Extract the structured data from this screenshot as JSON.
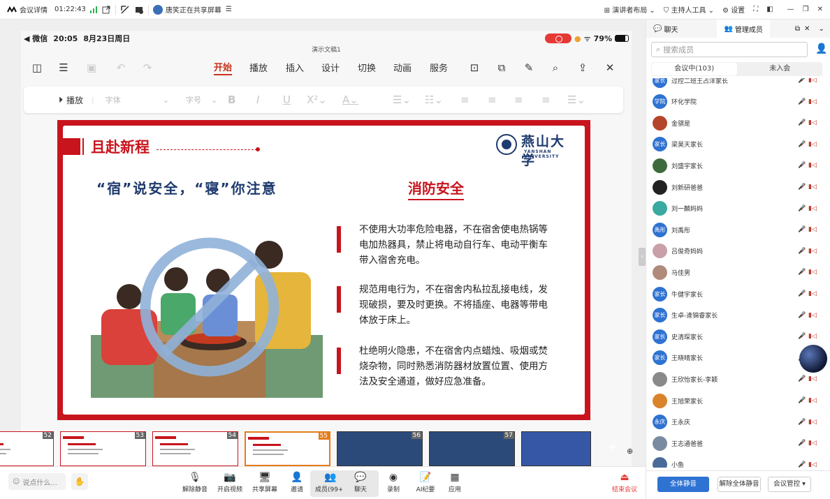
{
  "topbar": {
    "meeting_info": "会议详情",
    "timer": "01:22:43",
    "sharing_text": "唐笑正在共享屏幕",
    "presenter_layout": "演讲者布局",
    "host_tools": "主持人工具",
    "settings": "设置"
  },
  "phone": {
    "back_app": "◀ 微信",
    "time": "20:05",
    "date": "8月23日周日",
    "battery": "79%",
    "doc_title": "演示文稿1"
  },
  "app": {
    "tabs": [
      "开始",
      "播放",
      "插入",
      "设计",
      "切换",
      "动画",
      "服务"
    ],
    "active_tab": "开始"
  },
  "ribbon": {
    "play_label": "播放",
    "font": "字体",
    "size": "字号"
  },
  "slide": {
    "title": "且赴新程",
    "logo_cn": "燕山大学",
    "logo_en": "YANSHAN UNIVERSITY",
    "headline": "“宿”说安全，“寝”你注意",
    "section": "消防安全",
    "paragraphs": [
      "不使用大功率危险电器，不在宿舍使电热锅等电加热器具，禁止将电动自行车、电动平衡车带入宿舍充电。",
      "规范用电行为，不在宿舍内私拉乱接电线，发现破损，要及时更换。不将插座、电器等带电体放于床上。",
      "杜绝明火隐患，不在宿舍内点蜡烛、吸烟或焚烧杂物，同时熟悉消防器材放置位置、使用方法及安全通道，做好应急准备。"
    ]
  },
  "filmstrip": {
    "thumbs": [
      {
        "num": "52"
      },
      {
        "num": "53"
      },
      {
        "num": "54"
      },
      {
        "num": "55"
      },
      {
        "num": "56"
      },
      {
        "num": "57"
      }
    ],
    "selected": "55"
  },
  "bottombar": {
    "say_placeholder": "说点什么...",
    "buttons": [
      "解除静音",
      "开启视频",
      "共享屏幕",
      "邀请",
      "成员(99+)",
      "聊天",
      "录制",
      "AI纪要",
      "应用"
    ],
    "end": "结束会议"
  },
  "panel": {
    "tab_chat": "聊天",
    "tab_members": "管理成员",
    "search_placeholder": "搜索成员",
    "seg_in": "会议中(103)",
    "seg_out": "未入会",
    "members": [
      {
        "name": "过控二班王占洋家长",
        "badge": "家长",
        "color": "#2e72d2"
      },
      {
        "name": "环化学院",
        "badge": "学院",
        "color": "#2e72d2"
      },
      {
        "name": "金骐是",
        "badge": "",
        "color": "#b5452a"
      },
      {
        "name": "梁昊天家长",
        "badge": "家长",
        "color": "#2e72d2"
      },
      {
        "name": "刘盛宇家长",
        "badge": "",
        "color": "#3d6b3d"
      },
      {
        "name": "刘新研爸爸",
        "badge": "",
        "color": "#222222"
      },
      {
        "name": "刘一麟妈妈",
        "badge": "",
        "color": "#3aa9a0"
      },
      {
        "name": "刘禹彤",
        "badge": "禹彤",
        "color": "#2e72d2"
      },
      {
        "name": "吕俊奇妈妈",
        "badge": "",
        "color": "#c9a0a8"
      },
      {
        "name": "马佳男",
        "badge": "",
        "color": "#b08a7a"
      },
      {
        "name": "牛健宇家长",
        "badge": "家长",
        "color": "#2e72d2"
      },
      {
        "name": "生卓-逄锦睿家长",
        "badge": "家长",
        "color": "#2e72d2"
      },
      {
        "name": "史清琛家长",
        "badge": "家长",
        "color": "#2e72d2"
      },
      {
        "name": "王晓晴家长",
        "badge": "家长",
        "color": "#2e72d2"
      },
      {
        "name": "王欣怡家长-李颖",
        "badge": "",
        "color": "#8a8a8a"
      },
      {
        "name": "王旭荣家长",
        "badge": "",
        "color": "#d9832b"
      },
      {
        "name": "王永庆",
        "badge": "永庆",
        "color": "#2e72d2"
      },
      {
        "name": "王志通爸爸",
        "badge": "",
        "color": "#7a8aa0"
      },
      {
        "name": "小鱼",
        "badge": "",
        "color": "#4a6a9a"
      }
    ],
    "mute_all": "全体静音",
    "unmute_all": "解除全体静音",
    "control": "会议管控 ▾"
  }
}
